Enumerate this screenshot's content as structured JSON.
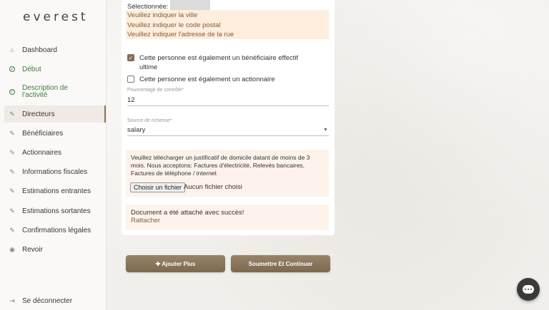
{
  "brand": {
    "logo": "everest"
  },
  "sidebar": {
    "items": [
      {
        "label": "Dashboard",
        "icon": "home-icon",
        "state": "default"
      },
      {
        "label": "Début",
        "icon": "check-circle-icon",
        "state": "done"
      },
      {
        "label": "Description de l'activité",
        "icon": "check-circle-icon",
        "state": "done"
      },
      {
        "label": "Directeurs",
        "icon": "pencil-icon",
        "state": "active"
      },
      {
        "label": "Bénéficiaires",
        "icon": "pencil-icon",
        "state": "default"
      },
      {
        "label": "Actionnaires",
        "icon": "pencil-icon",
        "state": "default"
      },
      {
        "label": "Informations fiscales",
        "icon": "pencil-icon",
        "state": "default"
      },
      {
        "label": "Estimations entrantes",
        "icon": "pencil-icon",
        "state": "default"
      },
      {
        "label": "Estimations sortantes",
        "icon": "pencil-icon",
        "state": "default"
      },
      {
        "label": "Confirmations légales",
        "icon": "pencil-icon",
        "state": "default"
      },
      {
        "label": "Revoir",
        "icon": "eye-icon",
        "state": "default"
      }
    ],
    "logout": {
      "label": "Se déconnecter",
      "icon": "logout-icon"
    }
  },
  "form": {
    "selected_label": "Sélectionnée:",
    "warnings": [
      "Veuillez indiquer la ville",
      "Veuillez indiquer le code postal",
      "Veuillez indiquer l'adresse de la rue"
    ],
    "checkbox_beneficiary": {
      "label_line1": "Cette personne est également un bénéficiaire effectif",
      "label_line2": "ultime",
      "checked": true
    },
    "checkbox_shareholder": {
      "label": "Cette personne est également un actionnaire",
      "checked": false
    },
    "control_percentage": {
      "label": "Pourcentage de contrôle*",
      "value": "12"
    },
    "wealth_source": {
      "label": "Source de richesse*",
      "value": "salary"
    },
    "upload": {
      "text_line1": "Veuillez télécharger un justificatif de domicile datant de moins de 3",
      "text_line2": "mois. Nous acceptons: Factures d'électricité, Relevés bancaires,",
      "text_line3": "Factures de téléphone / internet",
      "button_label": "Choisir un fichier",
      "no_file_label": "Aucun fichier choisi"
    },
    "success": {
      "message": "Document a été attaché avec succès!",
      "reattach_label": "Rattacher"
    }
  },
  "actions": {
    "add_more_label": "✚ Ajouter Plus",
    "submit_label": "Soumettre Et Continuer"
  },
  "chat": {
    "icon": "chat-icon"
  },
  "colors": {
    "accent": "#8a7560",
    "done_green": "#3f7a3f",
    "warning_bg": "#fdeedd",
    "warning_text": "#8a5a33"
  }
}
